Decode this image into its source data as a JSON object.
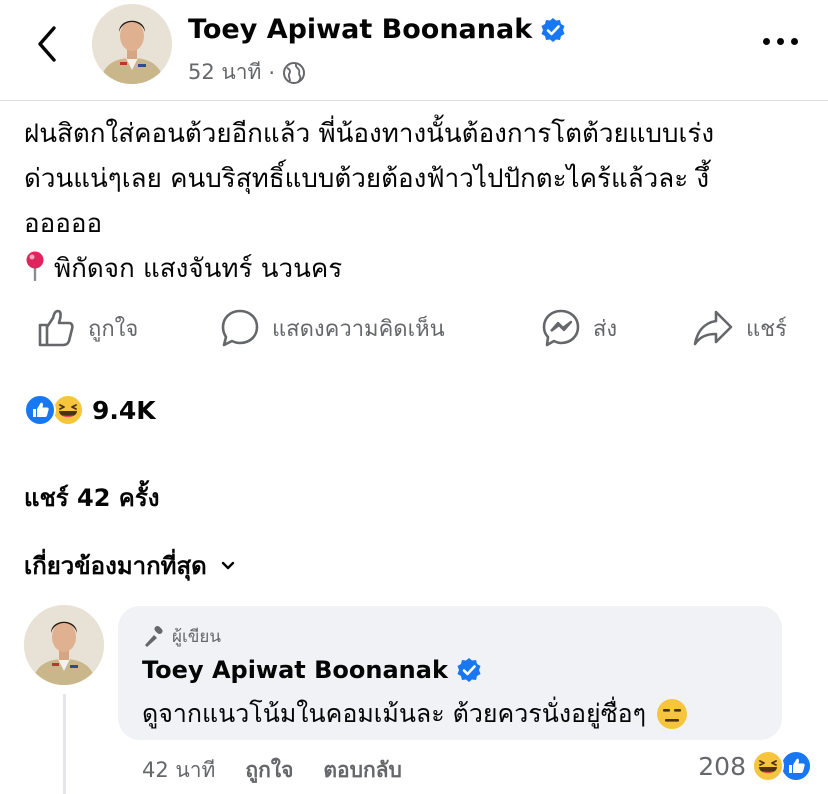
{
  "header": {
    "author_name": "Toey Apiwat Boonanak",
    "timestamp": "52 นาที",
    "separator": "·",
    "privacy_icon": "globe-icon"
  },
  "post": {
    "text_line1": "ฝนสิตกใส่คอนต้วยอีกแล้ว พี่น้องทางนั้นต้องการโตต้วยแบบเร่ง",
    "text_line2": "ด่วนแน่ๆเลย คนบริสุทธิ์แบบต้วยต้องฟ้าวไปปักตะไคร้แล้วละ งึ้",
    "text_line3": "อออออ",
    "location": "พิกัดจก แสงจันทร์ นวนคร"
  },
  "actions": {
    "like": "ถูกใจ",
    "comment": "แสดงความคิดเห็น",
    "send": "ส่ง",
    "share": "แชร์"
  },
  "stats": {
    "reaction_count": "9.4K",
    "shares": "แชร์ 42 ครั้ง"
  },
  "sort": {
    "label": "เกี่ยวข้องมากที่สุด"
  },
  "comment": {
    "author_tag": "ผู้เขียน",
    "author_name": "Toey Apiwat Boonanak",
    "text": "ดูจากแนวโน้มในคอมเม้นละ ต้วยควรนั่งอยู่ซื่อๆ",
    "time": "42 นาที",
    "like": "ถูกใจ",
    "reply": "ตอบกลับ",
    "reaction_count": "208"
  },
  "colors": {
    "verified_blue": "#1877f2",
    "secondary_text": "#65676b",
    "bubble_bg": "#f0f2f5",
    "emoji_yellow": "#f7c53d"
  }
}
